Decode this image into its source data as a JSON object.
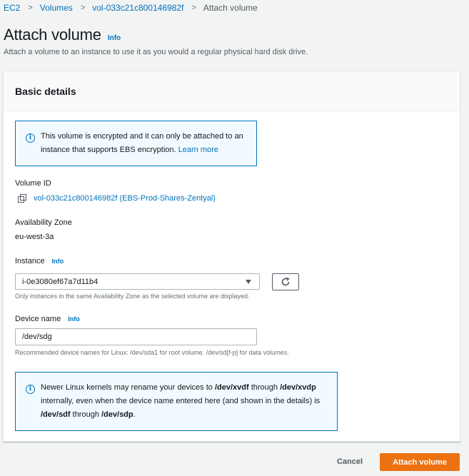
{
  "breadcrumb": {
    "items": [
      "EC2",
      "Volumes",
      "vol-033c21c800146982f"
    ],
    "current": "Attach volume",
    "separator": ">"
  },
  "header": {
    "title": "Attach volume",
    "info": "Info",
    "description": "Attach a volume to an instance to use it as you would a regular physical hard disk drive."
  },
  "panel": {
    "title": "Basic details"
  },
  "encryption_alert": {
    "text": "This volume is encrypted and it can only be attached to an instance that supports EBS encryption.",
    "link": "Learn more"
  },
  "volume_id": {
    "label": "Volume ID",
    "value": "vol-033c21c800146982f (EBS-Prod-Shares-Zentyal)"
  },
  "availability_zone": {
    "label": "Availability Zone",
    "value": "eu-west-3a"
  },
  "instance": {
    "label": "Instance",
    "info": "Info",
    "selected": "i-0e3080ef67a7d11b4",
    "hint": "Only instances in the same Availability Zone as the selected volume are displayed."
  },
  "device_name": {
    "label": "Device name",
    "info": "Info",
    "value": "/dev/sdg",
    "hint": "Recommended device names for Linux: /dev/sda1 for root volume. /dev/sd[f-p] for data volumes."
  },
  "kernel_alert": {
    "part1": "Newer Linux kernels may rename your devices to ",
    "b1": "/dev/xvdf",
    "part2": " through ",
    "b2": "/dev/xvdp",
    "part3": " internally, even when the device name entered here (and shown in the details) is ",
    "b3": "/dev/sdf",
    "part4": " through ",
    "b4": "/dev/sdp",
    "part5": "."
  },
  "footer": {
    "cancel": "Cancel",
    "submit": "Attach volume"
  },
  "colors": {
    "primary": "#ec7211",
    "link": "#0073bb",
    "alert_bg": "#f1faff"
  },
  "icons": [
    "chevron-right-icon",
    "info-icon",
    "copy-icon",
    "caret-down-icon",
    "refresh-icon"
  ]
}
